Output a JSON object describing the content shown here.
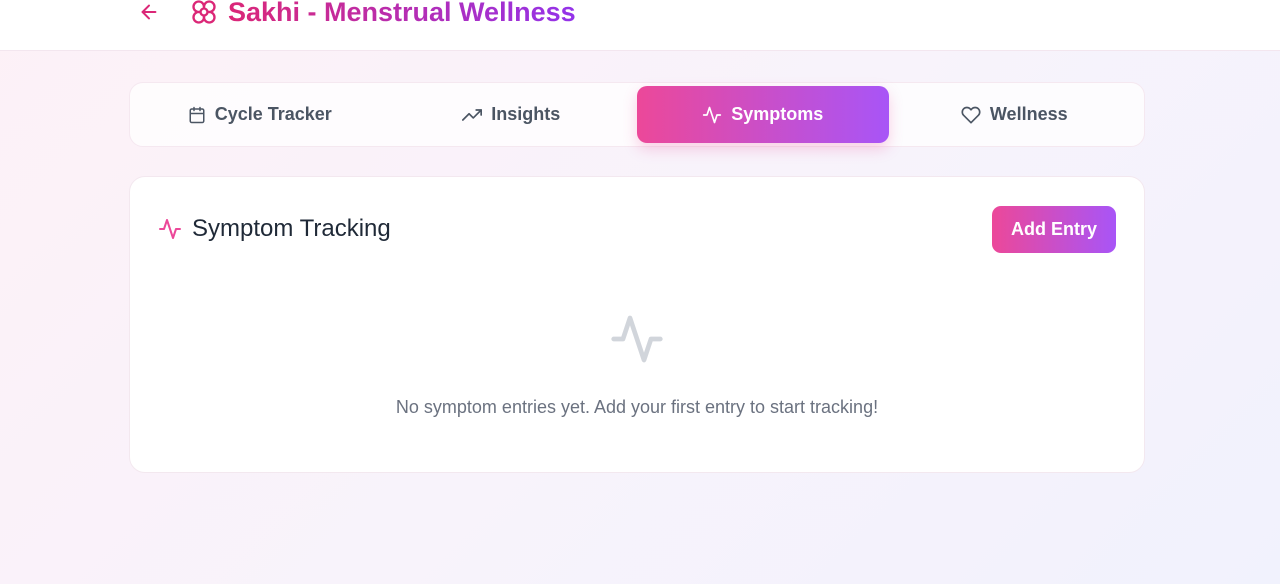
{
  "header": {
    "back_icon": "arrow-left-icon",
    "logo_icon": "flower-icon",
    "title": "Sakhi - Menstrual Wellness"
  },
  "tabs": [
    {
      "label": "Cycle Tracker",
      "icon": "calendar-icon",
      "active": false
    },
    {
      "label": "Insights",
      "icon": "trending-up-icon",
      "active": false
    },
    {
      "label": "Symptoms",
      "icon": "activity-icon",
      "active": true
    },
    {
      "label": "Wellness",
      "icon": "heart-icon",
      "active": false
    }
  ],
  "card": {
    "title": "Symptom Tracking",
    "title_icon": "activity-icon",
    "add_button_label": "Add Entry",
    "empty_icon": "activity-icon",
    "empty_message": "No symptom entries yet. Add your first entry to start tracking!"
  },
  "colors": {
    "brand_pink": "#ec4899",
    "brand_purple": "#a855f7",
    "title_pink": "#db2777",
    "title_purple": "#9333ea",
    "empty_icon": "#d1d5db"
  }
}
